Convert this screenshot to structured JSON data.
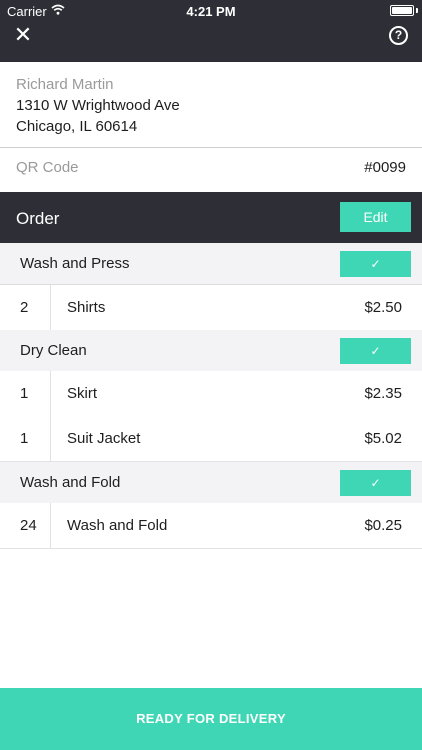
{
  "status_bar": {
    "carrier": "Carrier",
    "wifi_icon": "wifi-icon",
    "time": "4:21 PM",
    "battery_icon": "battery-icon"
  },
  "header": {
    "close_icon": "close-icon",
    "close_glyph": "✕",
    "help_icon": "help-icon",
    "help_glyph": "?"
  },
  "customer": {
    "name": "Richard Martin",
    "address_line1": "1310 W Wrightwood Ave",
    "address_line2": "Chicago, IL 60614"
  },
  "qr": {
    "label": "QR Code",
    "value": "#0099"
  },
  "order": {
    "title": "Order",
    "edit_label": "Edit"
  },
  "sections": [
    {
      "title": "Wash and Press",
      "check_glyph": "✓",
      "items": [
        {
          "qty": "2",
          "name": "Shirts",
          "price": "$2.50"
        }
      ]
    },
    {
      "title": "Dry Clean",
      "check_glyph": "✓",
      "items": [
        {
          "qty": "1",
          "name": "Skirt",
          "price": "$2.35"
        },
        {
          "qty": "1",
          "name": "Suit Jacket",
          "price": "$5.02"
        }
      ]
    },
    {
      "title": "Wash and Fold",
      "check_glyph": "✓",
      "items": [
        {
          "qty": "24",
          "name": "Wash and Fold",
          "price": "$0.25"
        }
      ]
    }
  ],
  "footer": {
    "ready_label": "READY FOR DELIVERY"
  },
  "colors": {
    "accent": "#3ed6b4",
    "dark_header": "#2e2e37",
    "section_bg": "#f3f3f5"
  }
}
